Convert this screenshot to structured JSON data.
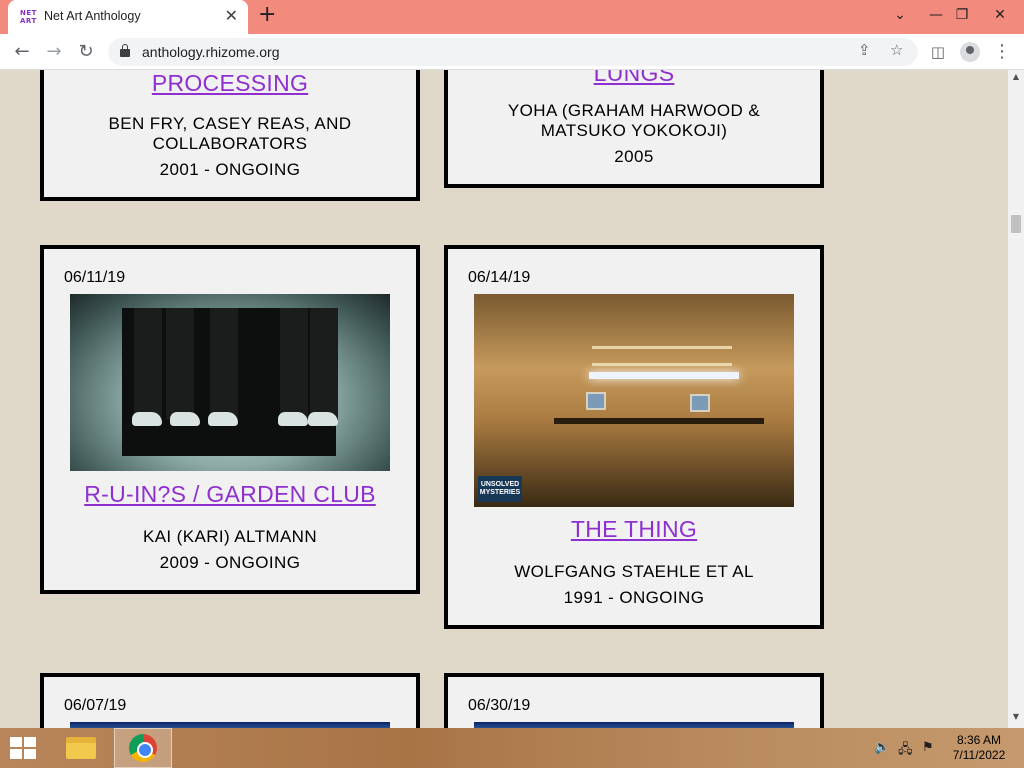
{
  "browser": {
    "tab_title": "Net Art Anthology",
    "favicon_line1": "NET",
    "favicon_line2": "ART",
    "url": "anthology.rhizome.org"
  },
  "cards": {
    "processing": {
      "title": "PROCESSING",
      "author": "BEN FRY, CASEY REAS, AND COLLABORATORS",
      "years": "2001 - ONGOING"
    },
    "lungs": {
      "title": "LUNGS",
      "author": "YOHA (GRAHAM HARWOOD & MATSUKO YOKOKOJI)",
      "years": "2005"
    },
    "ruins": {
      "date": "06/11/19",
      "title": "R-U-IN?S / GARDEN CLUB",
      "author": "KAI (KARI) ALTMANN",
      "years": "2009 - ONGOING"
    },
    "thing": {
      "date": "06/14/19",
      "title": "THE THING",
      "author": "WOLFGANG STAEHLE ET AL",
      "years": "1991 - ONGOING",
      "image_badge": "UNSOLVED MYSTERIES"
    },
    "next_left": {
      "date": "06/07/19"
    },
    "next_right": {
      "date": "06/30/19"
    }
  },
  "taskbar": {
    "time": "8:36 AM",
    "date": "7/11/2022"
  },
  "icons": {
    "back": "arrow-left",
    "forward": "arrow-right",
    "reload": "reload",
    "share": "share",
    "bookmark": "star",
    "sidepanel": "side-panel",
    "profile": "person",
    "menu": "more-vert"
  }
}
